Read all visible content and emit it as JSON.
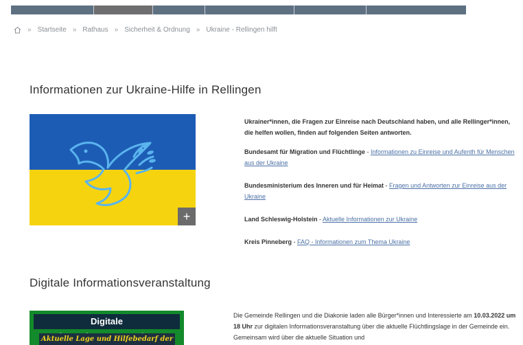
{
  "breadcrumb": {
    "items": [
      "Startseite",
      "Rathaus",
      "Sicherheit & Ordnung",
      "Ukraine - Rellingen hilft"
    ],
    "separator": "»"
  },
  "sections": {
    "ukraine": {
      "heading": "Informationen zur Ukraine-Hilfe in Rellingen",
      "intro": "Ukrainer*innen, die Fragen zur Einreise nach Deutschland haben, und alle Rellinger*innen, die helfen wollen, finden auf folgenden Seiten antworten.",
      "links": [
        {
          "org": "Bundesamt für Migration und Flüchtlinge",
          "sep": " - ",
          "link": "Informationen zu Einreise und Aufenth für Menschen aus der Ukraine"
        },
        {
          "org": "Bundesministerium des Inneren und für Heimat",
          "sep": " - ",
          "link": "Fragen und Antworten zur Einreise aus der Ukraine"
        },
        {
          "org": "Land Schleswig-Holstein",
          "sep": " - ",
          "link": "Aktuelle Informationen zur Ukraine"
        },
        {
          "org": "Kreis Pinneberg",
          "sep": " - ",
          "link": "FAQ - Informationen zum Thema Ukraine"
        }
      ],
      "expand_icon": "+"
    },
    "event": {
      "heading": "Digitale Informationsveranstaltung",
      "image_title": "Digitale Informationsveranstaltung",
      "image_subtitle": "Aktuelle Lage und Hilfebedarf der",
      "text_part1": "Die Gemeinde Rellingen und die Diakonie laden alle Bürger*innen und Interessierte am ",
      "date": "10.03.2022 um 18 Uhr",
      "text_part2": " zur digitalen Informationsveranstaltung über die aktuelle Flüchtlingslage in der Gemeinde ein. Gemeinsam wird über die aktuelle Situation und"
    }
  },
  "colors": {
    "nav_bar": "#5e7182",
    "flag_blue": "#1d5cb5",
    "flag_yellow": "#f5d40f",
    "link": "#4a6fa5"
  }
}
